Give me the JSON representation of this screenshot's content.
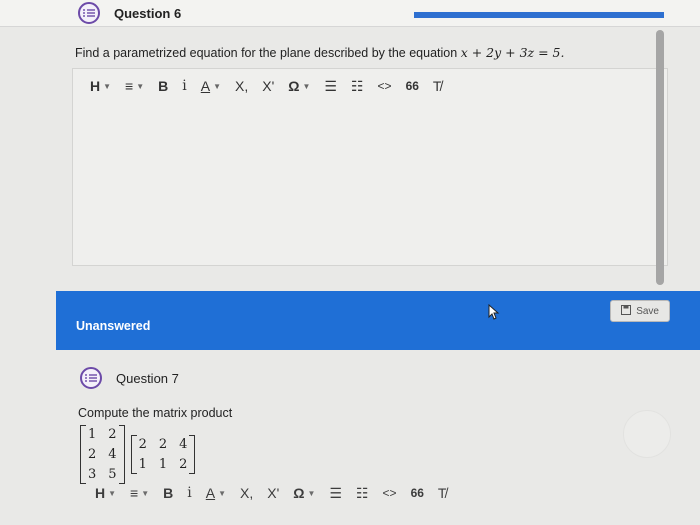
{
  "question6": {
    "title": "Question 6",
    "prompt": "Find a parametrized equation for the plane described by the equation",
    "equation": "x + 2y + 3z = 5.",
    "answer_value": ""
  },
  "toolbar": {
    "heading": "H",
    "align": "≡",
    "bold": "B",
    "italic": "i",
    "font_color": "A",
    "subscript": "X,",
    "superscript": "X'",
    "omega": "Ω",
    "numbered_list": "☰",
    "bullet_list": "☷",
    "code": "<>",
    "quote": "66",
    "clear_format": "T̸"
  },
  "status": {
    "label": "Unanswered",
    "save_label": "Save"
  },
  "question7": {
    "title": "Question 7",
    "prompt": "Compute the matrix product",
    "matrix_a": [
      [
        "1",
        "2"
      ],
      [
        "2",
        "4"
      ],
      [
        "3",
        "5"
      ]
    ],
    "matrix_b": [
      [
        "2",
        "2",
        "4"
      ],
      [
        "1",
        "1",
        "2"
      ]
    ]
  },
  "colors": {
    "accent": "#1f6fd6",
    "icon_purple": "#6c4aa8"
  }
}
